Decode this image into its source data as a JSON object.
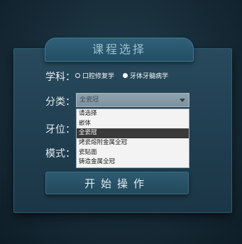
{
  "window": {
    "title": "课程选择"
  },
  "form": {
    "subject_label": "学科：",
    "subject_options": [
      {
        "label": "口腔修复学",
        "checked": false
      },
      {
        "label": "牙体牙髓病学",
        "checked": true
      }
    ],
    "category_label": "分类：",
    "category_value": "全瓷冠",
    "tooth_label": "牙位：",
    "mode_label": "模式：",
    "category_dropdown": {
      "options": [
        "请选择",
        "嵌体",
        "全瓷冠",
        "烤瓷熔附金属全冠",
        "瓷贴面",
        "铸造金属全冠"
      ],
      "selected_index": 2
    }
  },
  "actions": {
    "start_label": "开始操作"
  },
  "colors": {
    "panel": "#1f3d4f",
    "accent": "#2f6179",
    "selection": "#3a3a3a"
  }
}
